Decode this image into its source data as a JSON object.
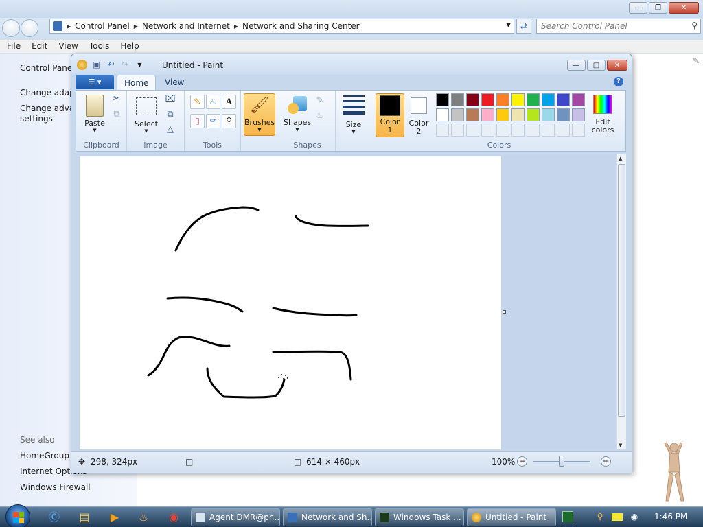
{
  "explorer": {
    "breadcrumb": [
      "Control Panel",
      "Network and Internet",
      "Network and Sharing Center"
    ],
    "search_placeholder": "Search Control Panel",
    "menu": [
      "File",
      "Edit",
      "View",
      "Tools",
      "Help"
    ],
    "sidebar": {
      "links": [
        "Control Panel",
        "Change adapt",
        "Change advar",
        "settings"
      ],
      "see_also_heading": "See also",
      "see_also": [
        "HomeGroup",
        "Internet Options",
        "Windows Firewall"
      ]
    }
  },
  "paint": {
    "title": "Untitled - Paint",
    "tabs": [
      "Home",
      "View"
    ],
    "groups": {
      "clipboard": {
        "label": "Clipboard",
        "paste": "Paste"
      },
      "image": {
        "label": "Image",
        "select": "Select"
      },
      "tools": {
        "label": "Tools"
      },
      "brushes": {
        "label": "Brushes"
      },
      "shapes": {
        "label": "Shapes",
        "button": "Shapes"
      },
      "size": {
        "label": "Size"
      },
      "colors": {
        "label": "Colors",
        "color1": "Color 1",
        "color2": "Color 2",
        "edit": "Edit colors"
      }
    },
    "palette_row1": [
      "#000000",
      "#7f7f7f",
      "#880015",
      "#ed1c24",
      "#ff7f27",
      "#fff200",
      "#22b14c",
      "#00a2e8",
      "#3f48cc",
      "#a349a4"
    ],
    "palette_row2": [
      "#ffffff",
      "#c3c3c3",
      "#b97a57",
      "#ffaec9",
      "#ffc90e",
      "#efe4b0",
      "#b5e61d",
      "#99d9ea",
      "#7092be",
      "#c8bfe7"
    ],
    "color1_value": "#000000",
    "color2_value": "#ffffff",
    "status": {
      "cursor_pos": "298, 324px",
      "canvas_size": "614 × 460px",
      "zoom": "100%"
    }
  },
  "taskbar": {
    "buttons": [
      "Agent.DMR@pr...",
      "Network and Sh...",
      "Windows Task ...",
      "Untitled - Paint"
    ],
    "clock": "1:46 PM"
  }
}
